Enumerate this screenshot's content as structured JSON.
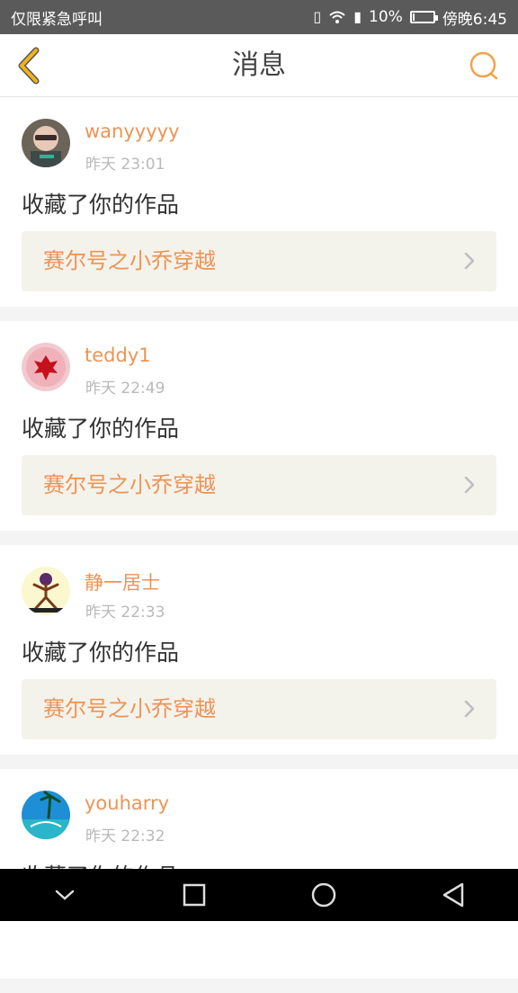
{
  "status": {
    "carrier": "仅限紧急呼叫",
    "battery": "10%",
    "time": "傍晚6:45"
  },
  "header": {
    "title": "消息"
  },
  "messages": [
    {
      "username": "wanyyyyy",
      "time": "昨天 23:01",
      "message": "收藏了你的作品",
      "work": "赛尔号之小乔穿越"
    },
    {
      "username": "teddy1",
      "time": "昨天 22:49",
      "message": "收藏了你的作品",
      "work": "赛尔号之小乔穿越"
    },
    {
      "username": "静一居士",
      "time": "昨天 22:33",
      "message": "收藏了你的作品",
      "work": "赛尔号之小乔穿越"
    },
    {
      "username": "youharry",
      "time": "昨天 22:32",
      "message": "收藏了你的作品",
      "work": ""
    }
  ],
  "colors": {
    "accent": "#ee9354",
    "back_arrow": "#f2b21b",
    "work_bg": "#f3f3ec"
  }
}
